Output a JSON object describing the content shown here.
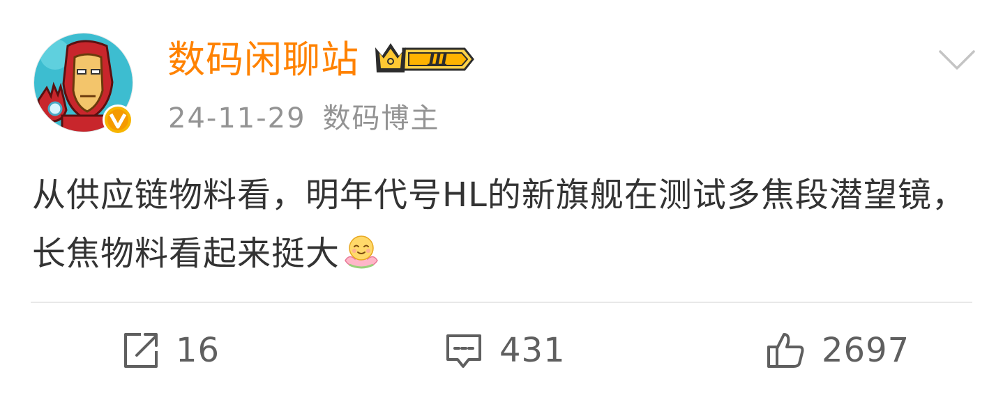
{
  "post": {
    "author": {
      "name": "数码闲聊站",
      "level": "Ⅲ",
      "verified_badge": "V"
    },
    "meta": {
      "date": "24-11-29",
      "tag": "数码博主"
    },
    "content_text": "从供应链物料看，明年代号HL的新旗舰在测试多焦段潜望镜，长焦物料看起来挺大",
    "emoji": "lotus-smile-emoji"
  },
  "actions": {
    "repost_count": "16",
    "comment_count": "431",
    "like_count": "2697"
  },
  "colors": {
    "username": "#ff8200",
    "meta": "#939393",
    "body_text": "#333333",
    "action_icon": "#5f5f5f",
    "badge_gold": "#f7b500"
  }
}
